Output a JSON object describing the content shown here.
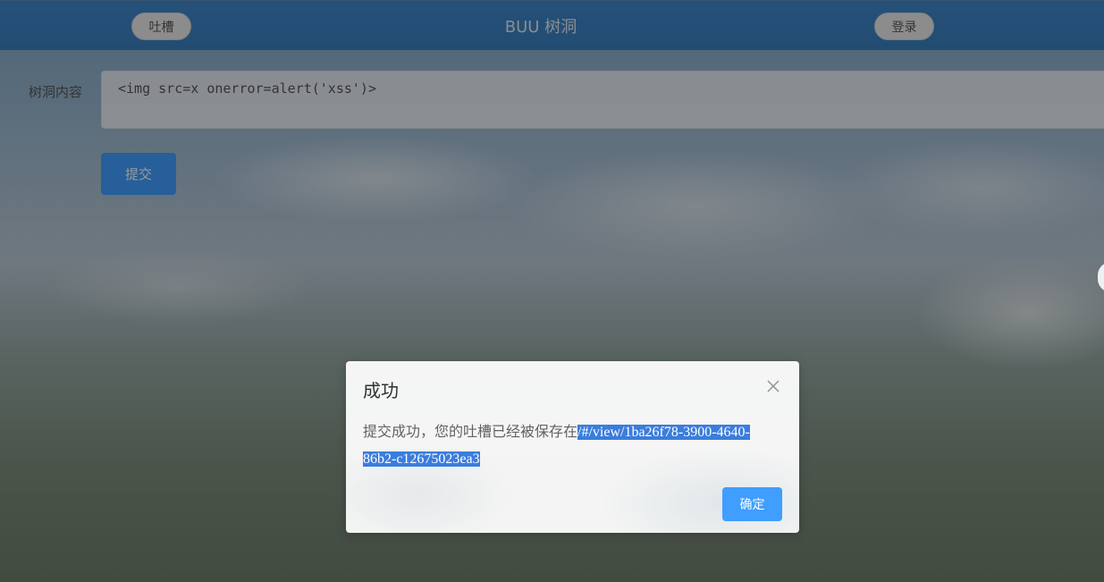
{
  "header": {
    "title": "BUU 树洞",
    "tucao_label": "吐槽",
    "login_label": "登录"
  },
  "form": {
    "content_label": "树洞内容",
    "content_value": "<img src=x onerror=alert('xss')>",
    "submit_label": "提交"
  },
  "dialog": {
    "title": "成功",
    "message": "提交成功，您的吐槽已经被保存在",
    "link": "/#/view/1ba26f78-3900-4640-86b2-c12675023ea3",
    "confirm_label": "确定"
  },
  "colors": {
    "header": "#3f86c8",
    "primary_button": "#409eff",
    "selection": "#3b7ddd"
  },
  "icons": {
    "close": "close-icon"
  }
}
